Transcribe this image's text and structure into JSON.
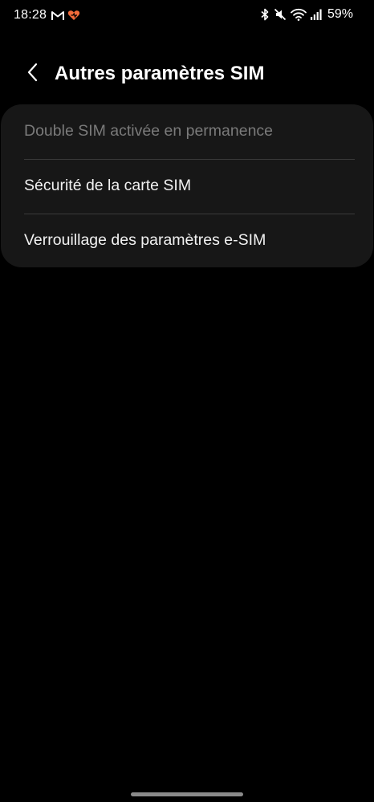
{
  "status_bar": {
    "time": "18:28",
    "battery": "59%",
    "left_icons": [
      "gmail-icon",
      "heart-app-icon"
    ],
    "right_icons": [
      "bluetooth-icon",
      "mute-icon",
      "wifi-icon",
      "signal-icon"
    ]
  },
  "header": {
    "title": "Autres paramètres SIM",
    "back_icon": "chevron-left-icon"
  },
  "settings": {
    "items": [
      {
        "label": "Double SIM activée en permanence",
        "enabled": false
      },
      {
        "label": "Sécurité de la carte SIM",
        "enabled": true
      },
      {
        "label": "Verrouillage des paramètres e-SIM",
        "enabled": true
      }
    ]
  },
  "colors": {
    "background": "#000000",
    "card": "#171717",
    "text_primary": "#f2f2f2",
    "text_disabled": "#7a7a7a",
    "divider": "#3a3a3a",
    "accent_orange": "#f26b3a"
  }
}
